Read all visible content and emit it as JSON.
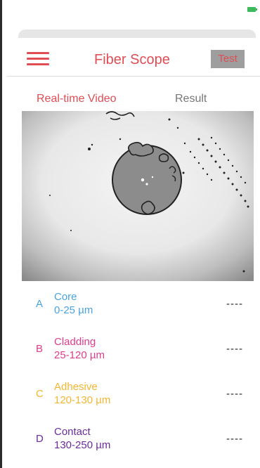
{
  "header": {
    "title": "Fiber Scope",
    "test_label": "Test"
  },
  "tabs": [
    {
      "label": "Real-time Video",
      "active": true
    },
    {
      "label": "Result",
      "active": false
    }
  ],
  "zones": [
    {
      "letter": "A",
      "name": "Core",
      "range": "0-25 µm",
      "value": "----",
      "color": "#4aa3df"
    },
    {
      "letter": "B",
      "name": "Cladding",
      "range": "25-120 µm",
      "value": "----",
      "color": "#e03c8c"
    },
    {
      "letter": "C",
      "name": "Adhesive",
      "range": "120-130 µm",
      "value": "----",
      "color": "#f2b632"
    },
    {
      "letter": "D",
      "name": "Contact",
      "range": "130-250 µm",
      "value": "----",
      "color": "#6a2c9c"
    }
  ],
  "colors": {
    "accent": "#e04d55",
    "test_button_bg": "#9e9e9e",
    "battery": "#3dbb5c"
  },
  "icons": [
    "battery-icon",
    "hamburger-menu-icon"
  ]
}
